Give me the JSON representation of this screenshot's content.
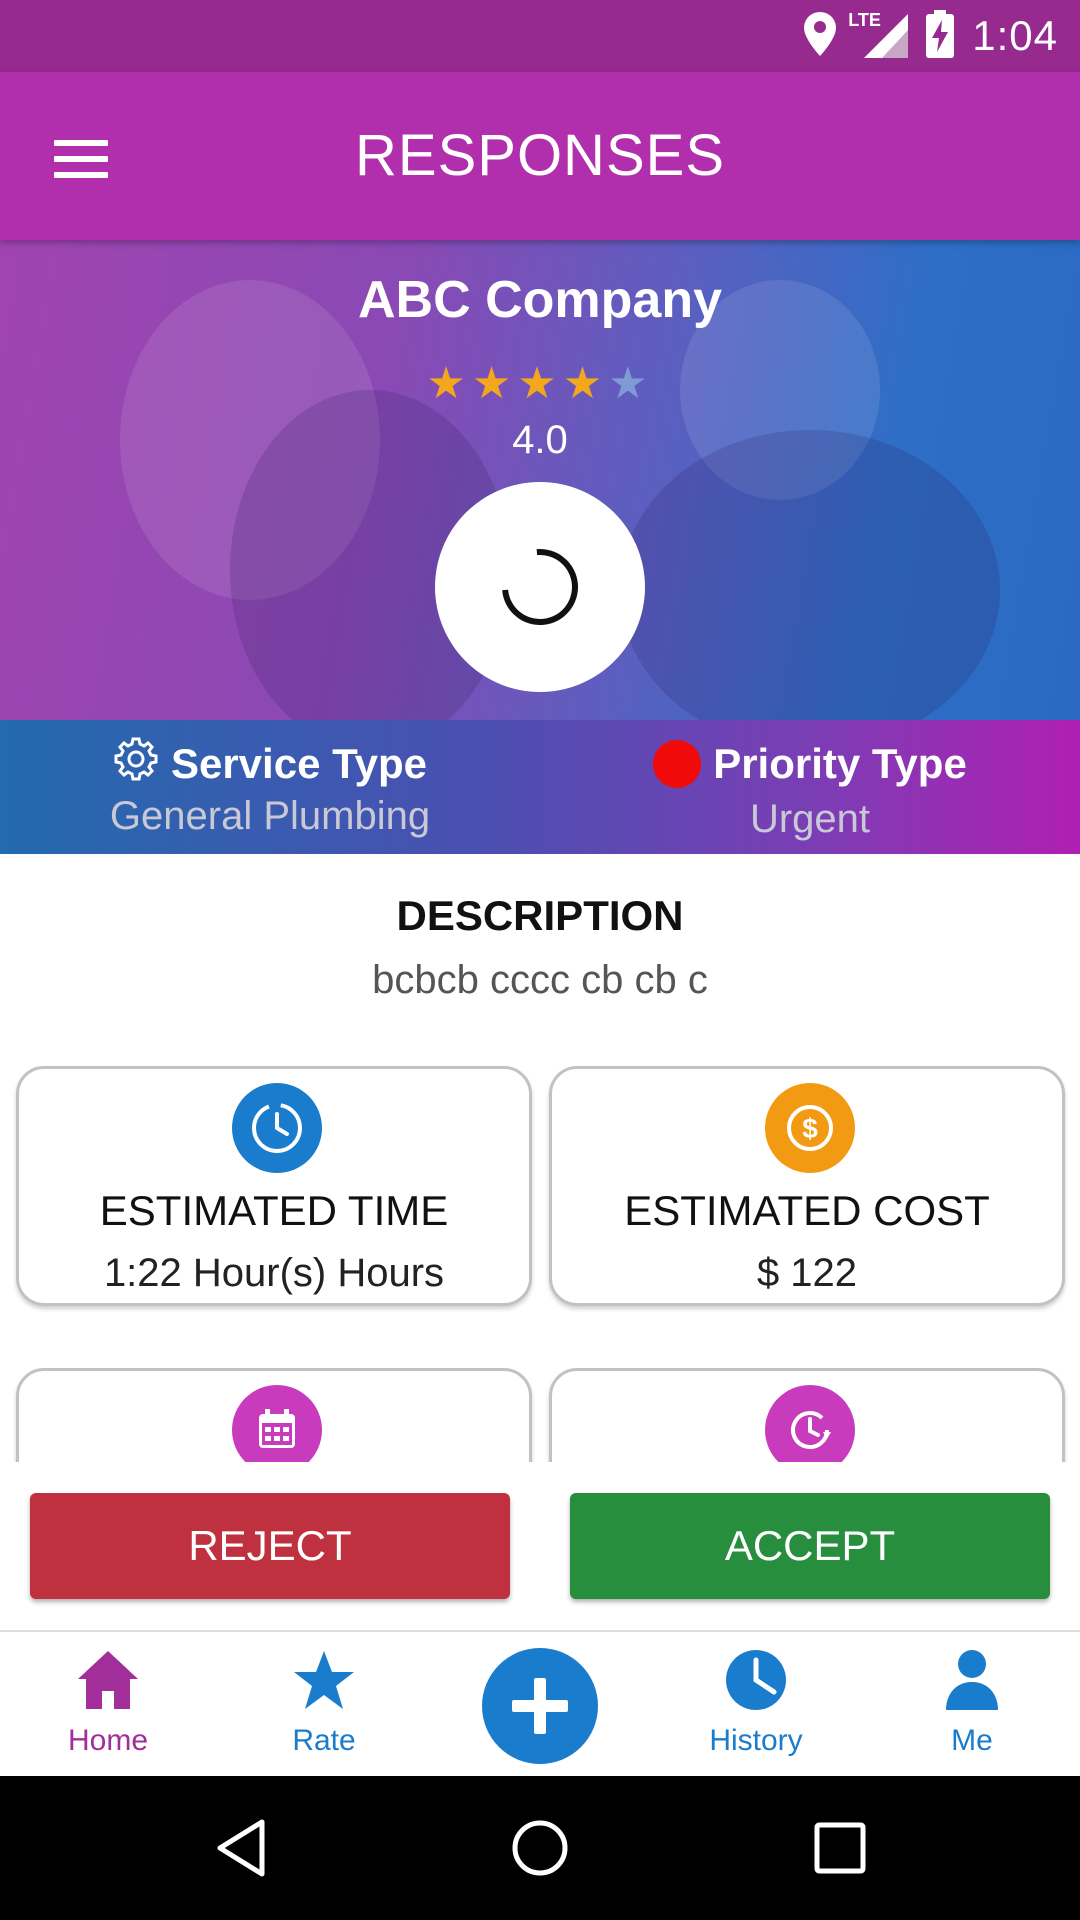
{
  "status_bar": {
    "time": "1:04",
    "network_label": "LTE",
    "icons": [
      "location-icon",
      "signal-icon",
      "battery-charging-icon"
    ],
    "color": "#962a8e"
  },
  "app_bar": {
    "title": "RESPONSES",
    "menu_icon": "menu-icon",
    "color": "#b12fac"
  },
  "provider": {
    "name": "ABC Company",
    "rating_value": 4,
    "rating_max": 5,
    "rating_text": "4.0"
  },
  "info": {
    "service_label": "Service Type",
    "service_value": "General Plumbing",
    "priority_label": "Priority Type",
    "priority_value": "Urgent",
    "priority_color": "#f10a0a"
  },
  "description": {
    "title": "DESCRIPTION",
    "text": "bcbcb cccc cb cb c"
  },
  "cards": {
    "estimated_time": {
      "title": "ESTIMATED TIME",
      "value": "1:22 Hour(s) Hours",
      "icon": "clock-icon",
      "color": "#1a7ccc"
    },
    "estimated_cost": {
      "title": "ESTIMATED COST",
      "value": "$ 122",
      "icon": "dollar-icon",
      "color": "#f39a13"
    },
    "date": {
      "icon": "calendar-icon",
      "color": "#c93bbd"
    },
    "time_slot": {
      "icon": "clock-arrow-icon",
      "color": "#c93bbd"
    }
  },
  "actions": {
    "reject_label": "REJECT",
    "accept_label": "ACCEPT",
    "reject_color": "#c03140",
    "accept_color": "#268e3c"
  },
  "bottom_nav": {
    "items": [
      {
        "label": "Home",
        "icon": "home-icon",
        "active": true
      },
      {
        "label": "Rate",
        "icon": "star-icon",
        "active": false
      },
      {
        "label": "",
        "icon": "plus-icon",
        "active": false
      },
      {
        "label": "History",
        "icon": "history-icon",
        "active": false
      },
      {
        "label": "Me",
        "icon": "person-icon",
        "active": false
      }
    ],
    "active_color": "#a22f99",
    "inactive_color": "#1a7ccc"
  },
  "system_nav": {
    "icons": [
      "back-icon",
      "home-circle-icon",
      "recents-icon"
    ]
  }
}
